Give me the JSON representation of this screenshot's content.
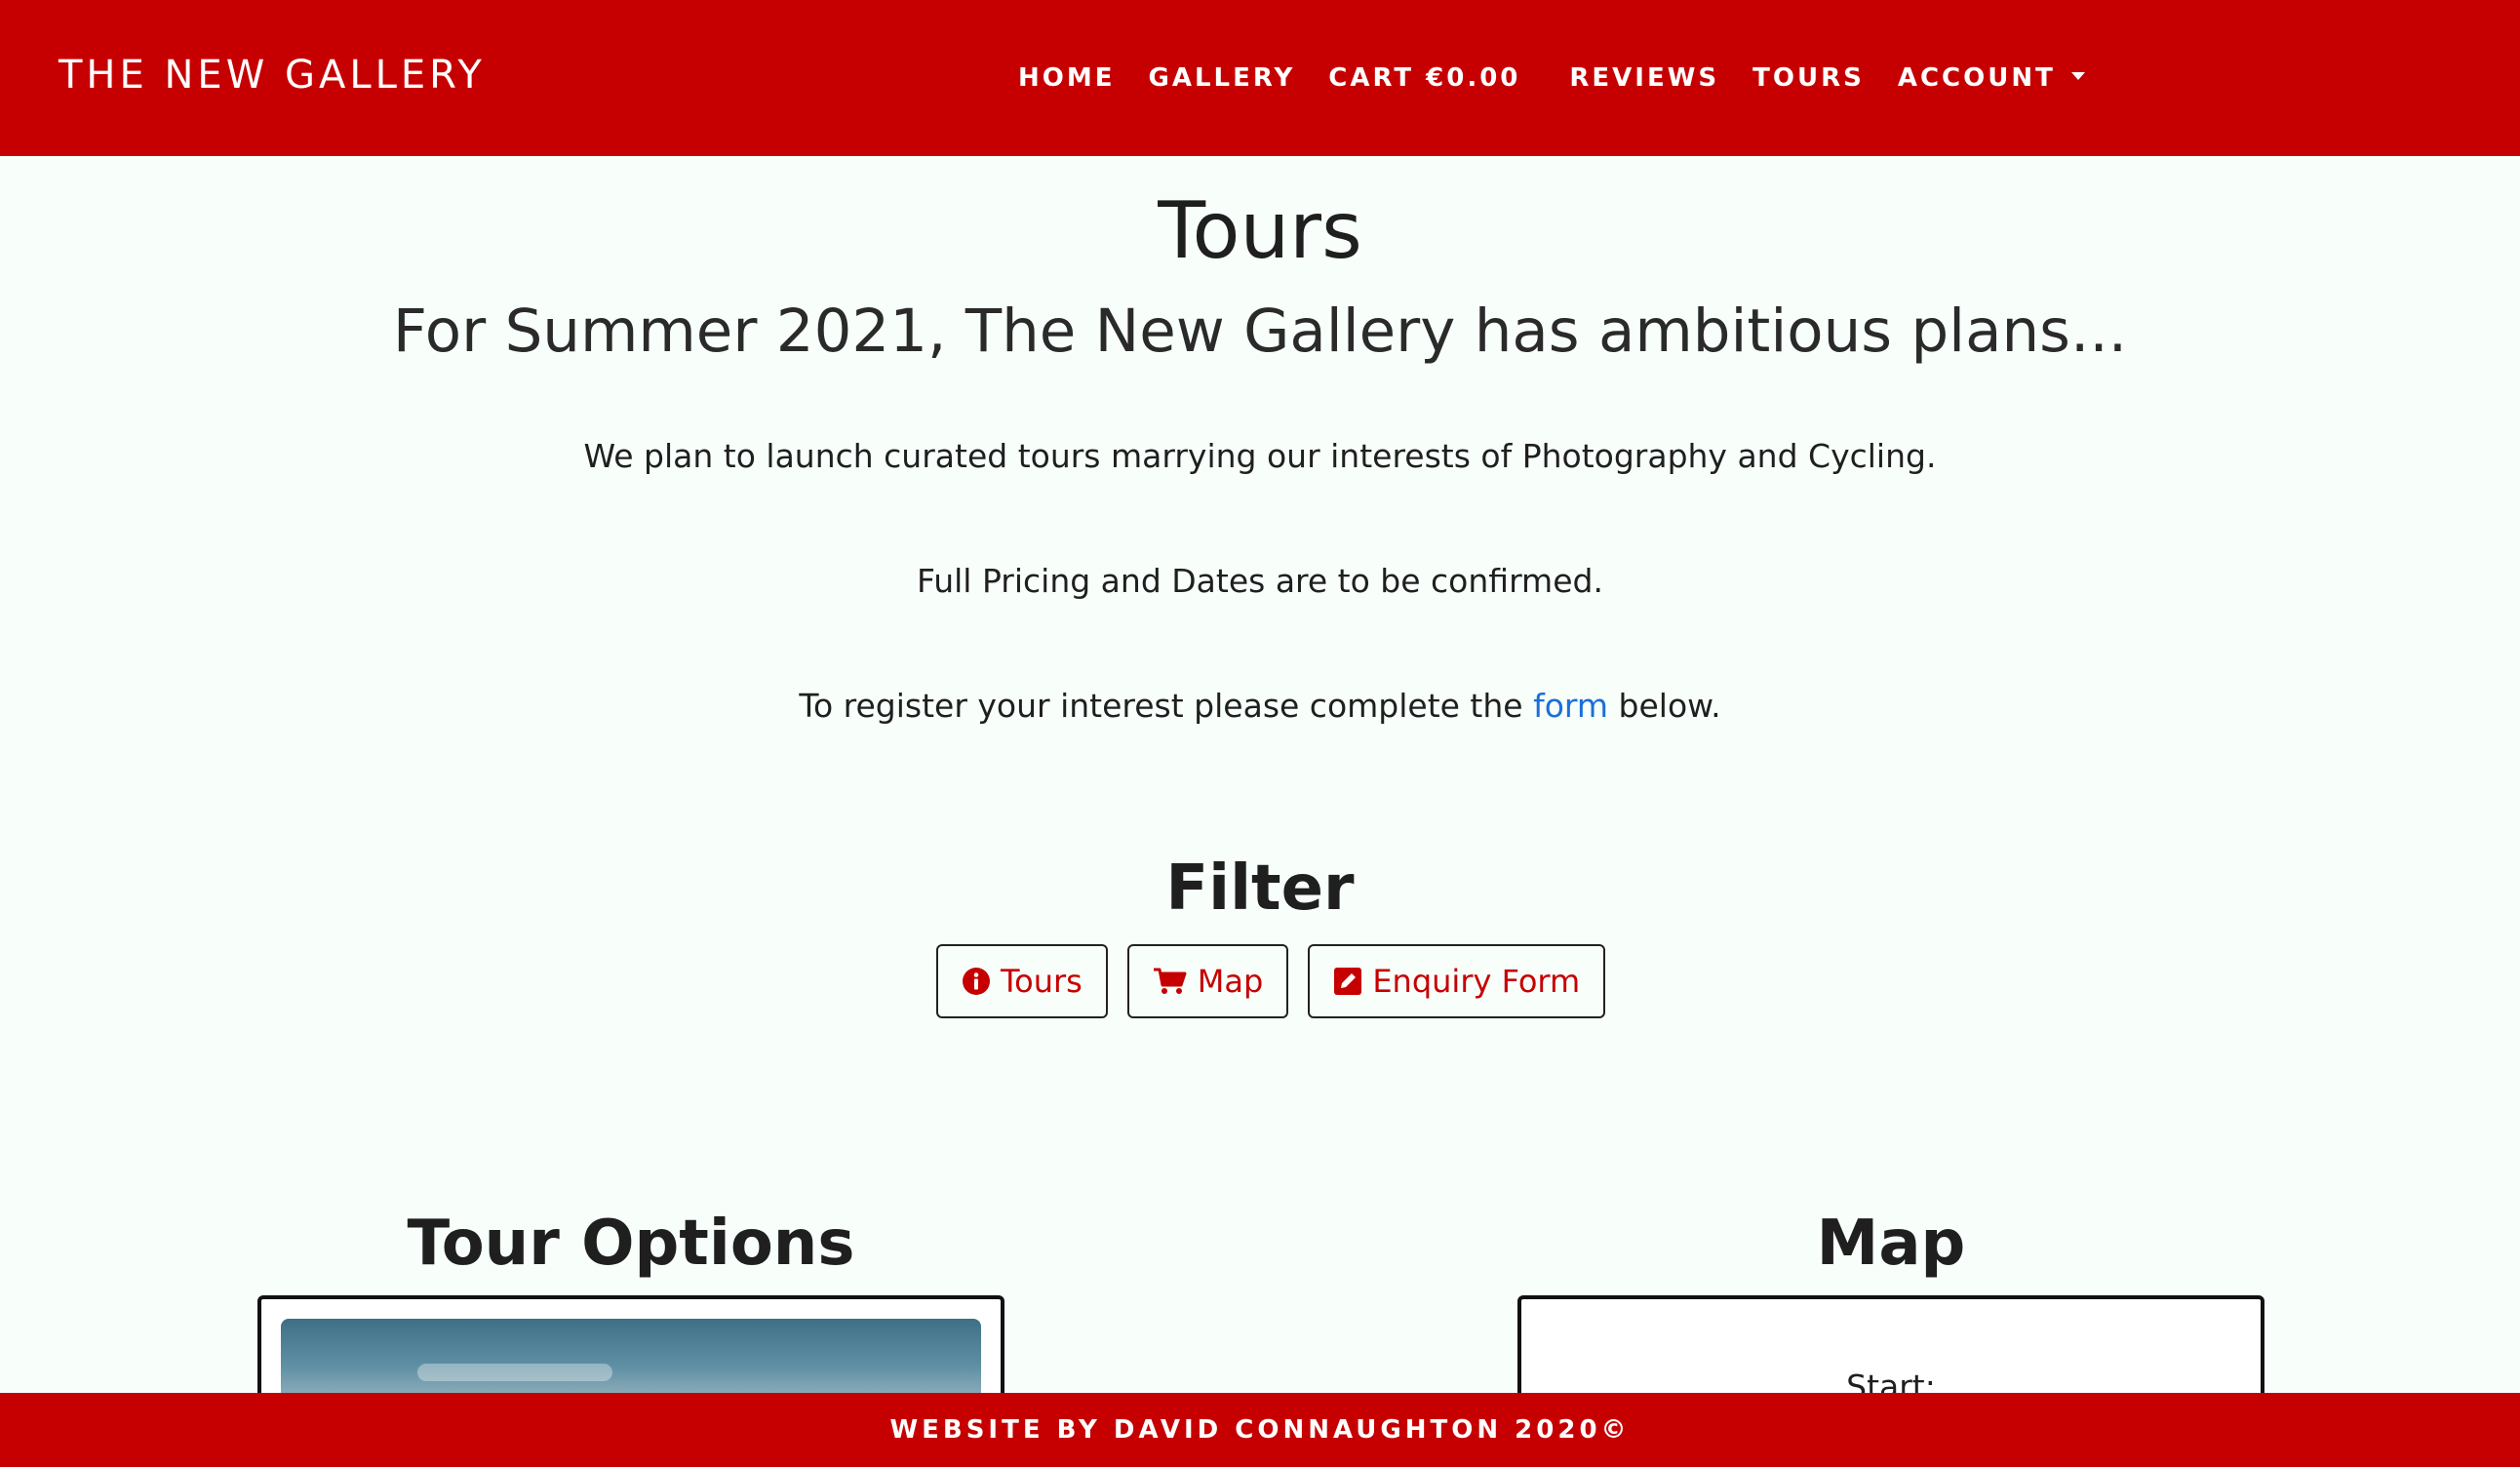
{
  "header": {
    "brand": "THE NEW GALLERY",
    "nav": {
      "home": "HOME",
      "gallery": "GALLERY",
      "cart": "CART €0.00",
      "reviews": "REVIEWS",
      "tours": "TOURS",
      "account": "ACCOUNT"
    }
  },
  "main": {
    "title": "Tours",
    "subtitle": "For Summer 2021, The New Gallery has ambitious plans...",
    "para1": "We plan to launch curated tours marrying our interests of Photography and Cycling.",
    "para2": "Full Pricing and Dates are to be confirmed.",
    "para3_before": "To register your interest please complete the ",
    "para3_link": "form",
    "para3_after": " below."
  },
  "filter": {
    "title": "Filter",
    "buttons": [
      {
        "label": "Tours",
        "icon": "info-circle-icon"
      },
      {
        "label": "Map",
        "icon": "shopping-cart-icon"
      },
      {
        "label": "Enquiry Form",
        "icon": "pencil-square-icon"
      }
    ]
  },
  "tour_options": {
    "title": "Tour Options"
  },
  "map": {
    "title": "Map",
    "start_label": "Start:"
  },
  "footer": {
    "text": "WEBSITE BY DAVID CONNAUGHTON 2020©"
  },
  "colors": {
    "brand_red": "#c60000",
    "link_blue": "#1b6fd8",
    "background": "#f8fffb"
  }
}
